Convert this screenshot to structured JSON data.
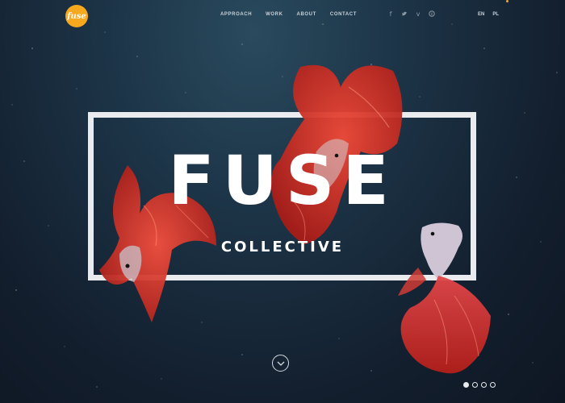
{
  "brand": {
    "logo_text": "fuse",
    "accent_color": "#f6a81f"
  },
  "nav": {
    "items": [
      "APPROACH",
      "WORK",
      "ABOUT",
      "CONTACT"
    ]
  },
  "social": {
    "icons": [
      "facebook-icon",
      "twitter-icon",
      "vimeo-icon",
      "pinterest-icon"
    ],
    "glyphs": [
      "f",
      "t",
      "v",
      "p"
    ]
  },
  "lang": {
    "items": [
      "EN",
      "PL"
    ]
  },
  "hero": {
    "title": "FUSE",
    "subtitle": "COLLECTIVE",
    "fish_color": "#d9352b"
  },
  "pager": {
    "count": 4,
    "active_index": 0
  }
}
